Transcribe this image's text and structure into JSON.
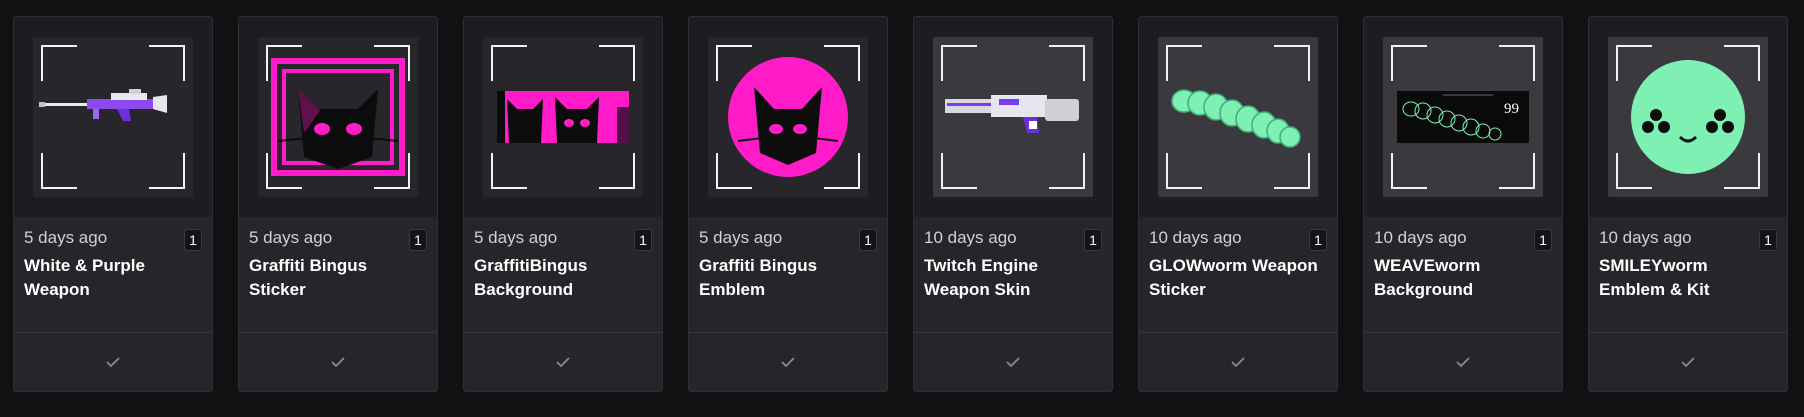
{
  "items": [
    {
      "time": "5 days ago",
      "qty": "1",
      "name": "White & Purple Weapon",
      "thumb_icon": "sniper-rifle-icon"
    },
    {
      "time": "5 days ago",
      "qty": "1",
      "name": "Graffiti Bingus Sticker",
      "thumb_icon": "cat-sticker-icon"
    },
    {
      "time": "5 days ago",
      "qty": "1",
      "name": "GraffitiBingus Background",
      "thumb_icon": "cat-banner-icon"
    },
    {
      "time": "5 days ago",
      "qty": "1",
      "name": "Graffiti Bingus Emblem",
      "thumb_icon": "cat-emblem-icon"
    },
    {
      "time": "10 days ago",
      "qty": "1",
      "name": "Twitch Engine Weapon Skin",
      "thumb_icon": "heavy-gun-icon"
    },
    {
      "time": "10 days ago",
      "qty": "1",
      "name": "GLOWworm Weapon Sticker",
      "thumb_icon": "worm-sticker-icon"
    },
    {
      "time": "10 days ago",
      "qty": "1",
      "name": "WEAVEworm Background",
      "thumb_icon": "worm-banner-icon",
      "banner_number": "99"
    },
    {
      "time": "10 days ago",
      "qty": "1",
      "name": "SMILEYworm Emblem & Kit",
      "thumb_icon": "smiley-emblem-icon"
    }
  ],
  "footer_icon": "checkmark-icon",
  "colors": {
    "magenta": "#ff1cc8",
    "mint": "#7ef0b4",
    "purple": "#7a3cf0",
    "card": "#25252a",
    "background": "#111113"
  }
}
